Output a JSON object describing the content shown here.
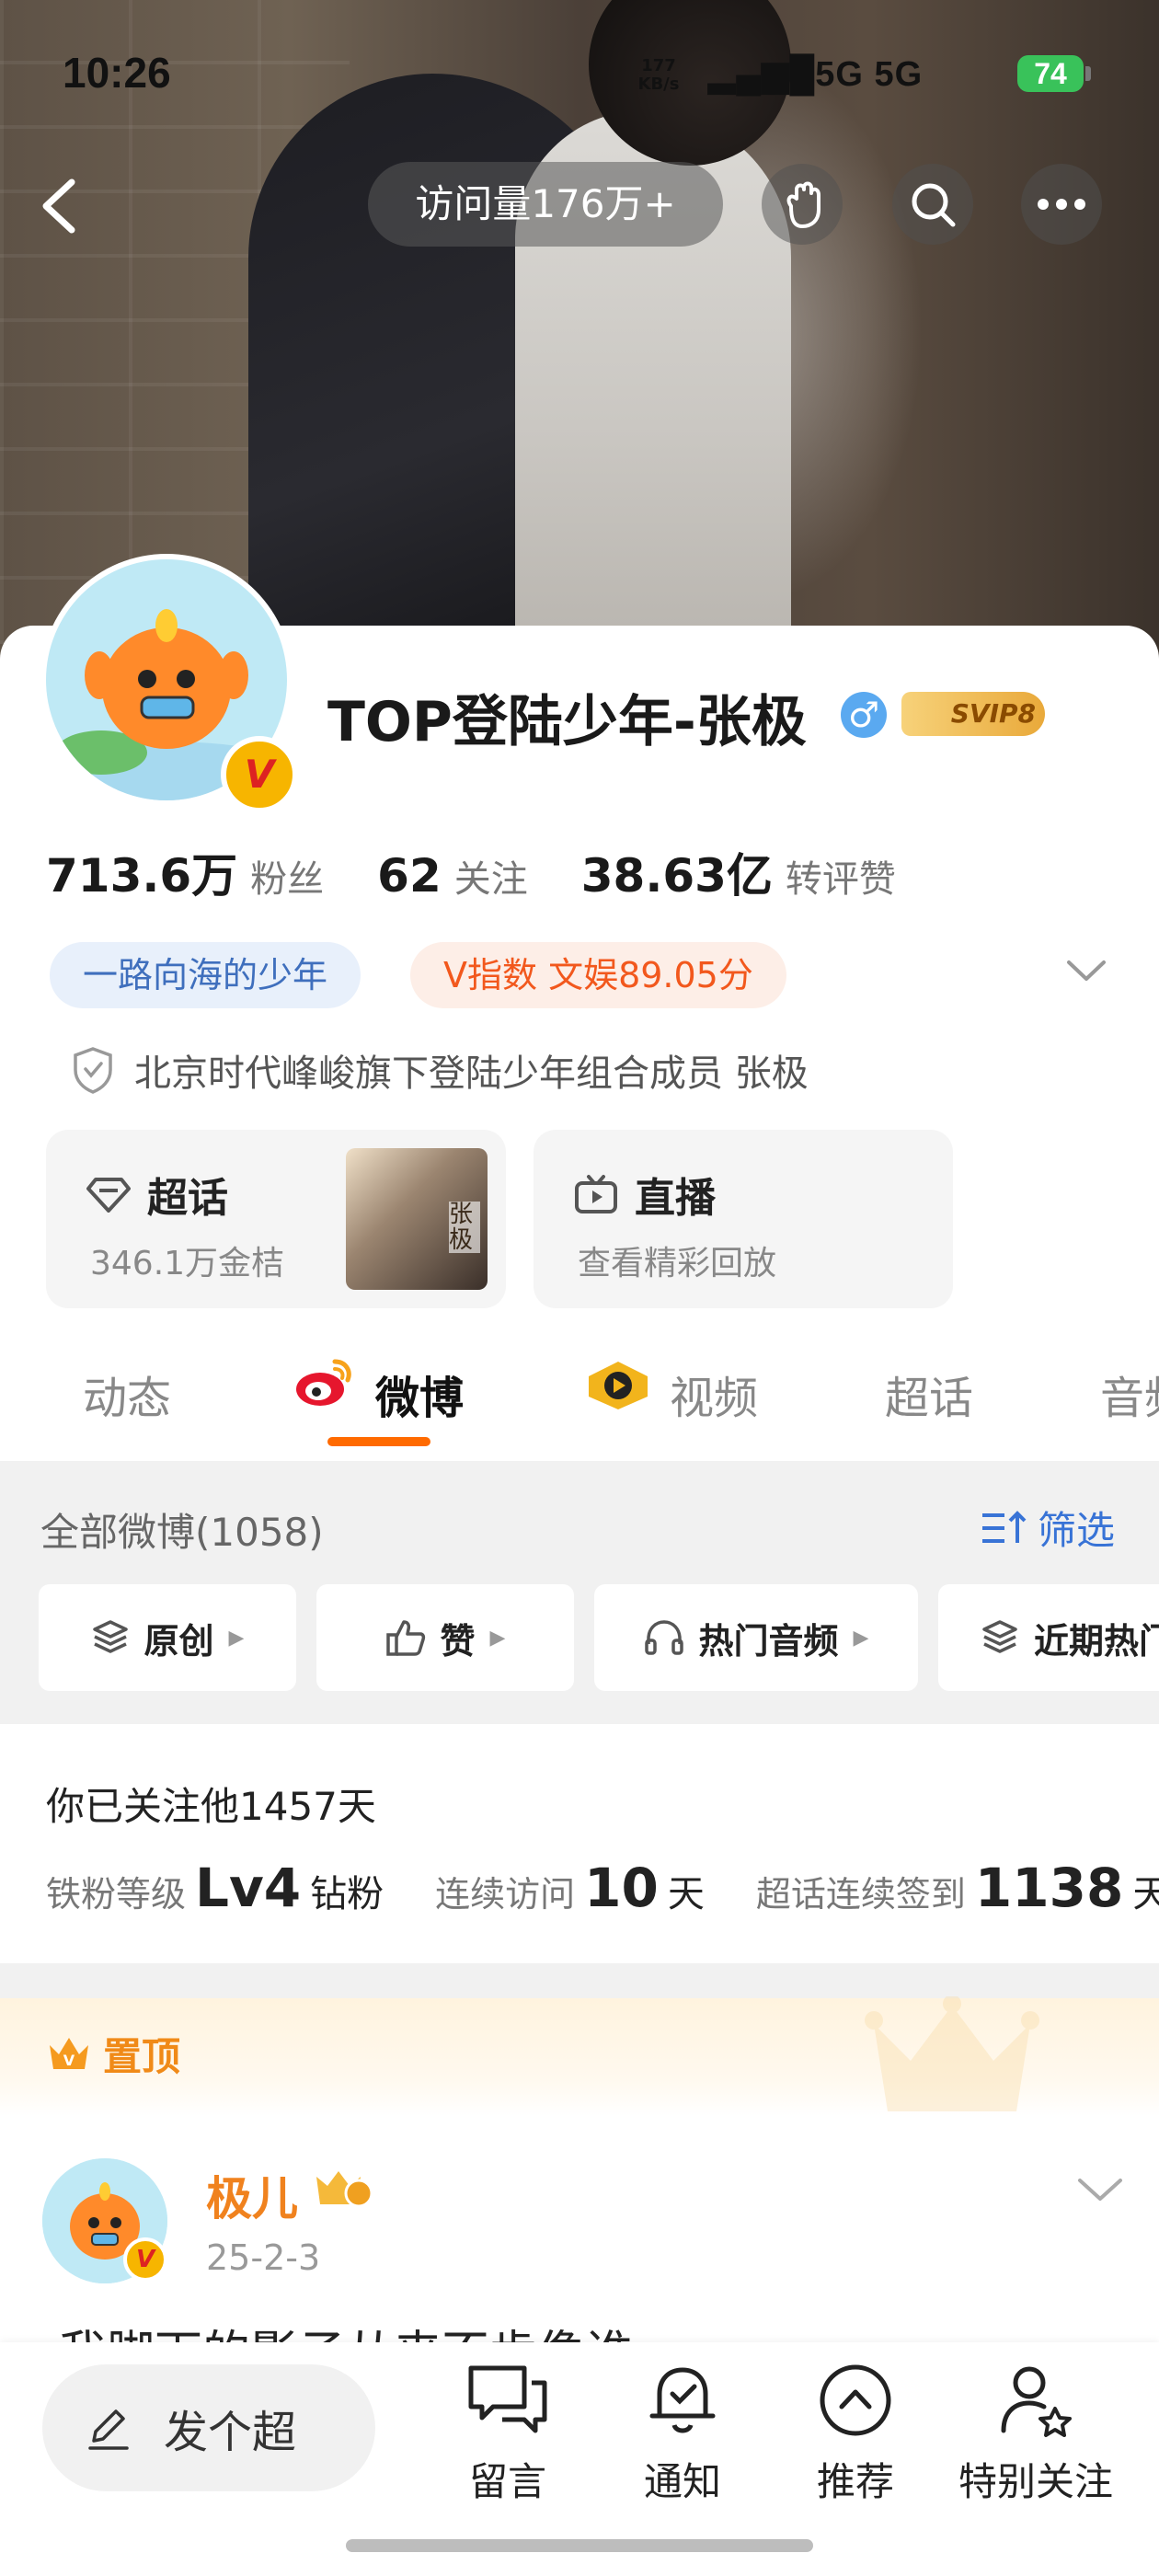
{
  "status_bar": {
    "time": "10:26",
    "speed_value": "177",
    "speed_unit": "KB/s",
    "network": "5G 5G",
    "battery": "74"
  },
  "top_nav": {
    "visits": "访问量176万+"
  },
  "profile": {
    "username": "TOP登陆少年-张极",
    "gender_symbol": "♂",
    "svip_label": "SVIP8",
    "verified_badge": "V",
    "stats": [
      {
        "value": "713.6万",
        "label": "粉丝"
      },
      {
        "value": "62",
        "label": "关注"
      },
      {
        "value": "38.63亿",
        "label": "转评赞"
      }
    ],
    "tags": {
      "signature": "一路向海的少年",
      "v_index": "V指数 文娱89.05分"
    },
    "verification": "北京时代峰峻旗下登陆少年组合成员 张极"
  },
  "features": {
    "supertopic": {
      "title": "超话",
      "sub": "346.1万金桔",
      "thumb_text": "张极"
    },
    "live": {
      "title": "直播",
      "sub": "查看精彩回放"
    }
  },
  "tabs": [
    {
      "label": "动态"
    },
    {
      "label": "微博"
    },
    {
      "label": "视频"
    },
    {
      "label": "超话"
    },
    {
      "label": "音频"
    }
  ],
  "filter": {
    "all_weibo": "全部微博(1058)",
    "filter_label": "筛选",
    "chips": [
      {
        "label": "原创"
      },
      {
        "label": "赞"
      },
      {
        "label": "热门音频"
      },
      {
        "label": "近期热门"
      }
    ]
  },
  "fan_info": {
    "follow_days": "你已关注他1457天",
    "level_label": "铁粉等级",
    "level_value": "Lv4",
    "level_suffix": "钻粉",
    "visit_label": "连续访问",
    "visit_value": "10",
    "visit_unit": "天",
    "checkin_label": "超话连续签到",
    "checkin_value": "1138",
    "checkin_unit": "天"
  },
  "pinned": {
    "label": "置顶"
  },
  "post": {
    "author": "极儿",
    "date": "25-2-3",
    "text": "我脚下的影子从来不肯像谁"
  },
  "bottom_bar": {
    "compose": "发个超",
    "items": [
      {
        "label": "留言"
      },
      {
        "label": "通知"
      },
      {
        "label": "推荐"
      },
      {
        "label": "特别关注"
      }
    ]
  },
  "colors": {
    "accent_orange": "#ff6a00",
    "link_blue": "#3873d6",
    "tag_blue_bg": "#e8f0fb",
    "tag_orange_bg": "#fdeee7",
    "battery_green": "#39c25a"
  }
}
